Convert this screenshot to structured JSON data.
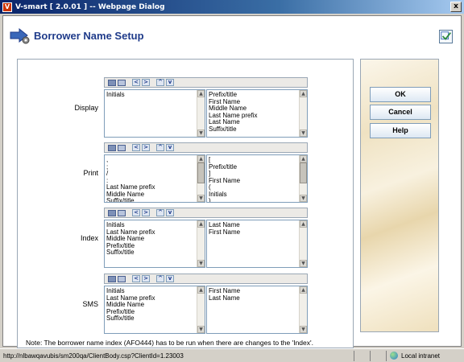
{
  "window": {
    "title": "V-smart [ 2.0.01 ] -- Webpage Dialog",
    "close_label": "x"
  },
  "header": {
    "title": "Borrower Name Setup"
  },
  "sections": [
    {
      "label": "Display",
      "left_items": [
        "Initials"
      ],
      "right_items": [
        "Prefix/title",
        "First Name",
        "Middle Name",
        "Last Name prefix",
        "Last Name",
        "Suffix/title"
      ]
    },
    {
      "label": "Print",
      "left_items": [
        ",",
        ";",
        "/",
        ":",
        "Last Name prefix",
        "Middle Name",
        "Suffix/title"
      ],
      "right_items": [
        "[",
        "Prefix/title",
        "]",
        "First Name",
        "(",
        "Initials",
        ")"
      ]
    },
    {
      "label": "Index",
      "left_items": [
        "Initials",
        "Last Name prefix",
        "Middle Name",
        "Prefix/title",
        "Suffix/title"
      ],
      "right_items": [
        "Last Name",
        "First Name"
      ]
    },
    {
      "label": "SMS",
      "left_items": [
        "Initials",
        "Last Name prefix",
        "Middle Name",
        "Prefix/title",
        "Suffix/title"
      ],
      "right_items": [
        "First Name",
        "Last Name"
      ]
    }
  ],
  "note": "Note: The borrower name index (AFO444) has to be run when there are changes to the 'Index'.",
  "buttons": {
    "ok": "OK",
    "cancel": "Cancel",
    "help": "Help"
  },
  "statusbar": {
    "url": "http://nlbawqavubis/sm200qa/ClientBody.csp?ClientId=1.23003",
    "zone": "Local intranet"
  }
}
